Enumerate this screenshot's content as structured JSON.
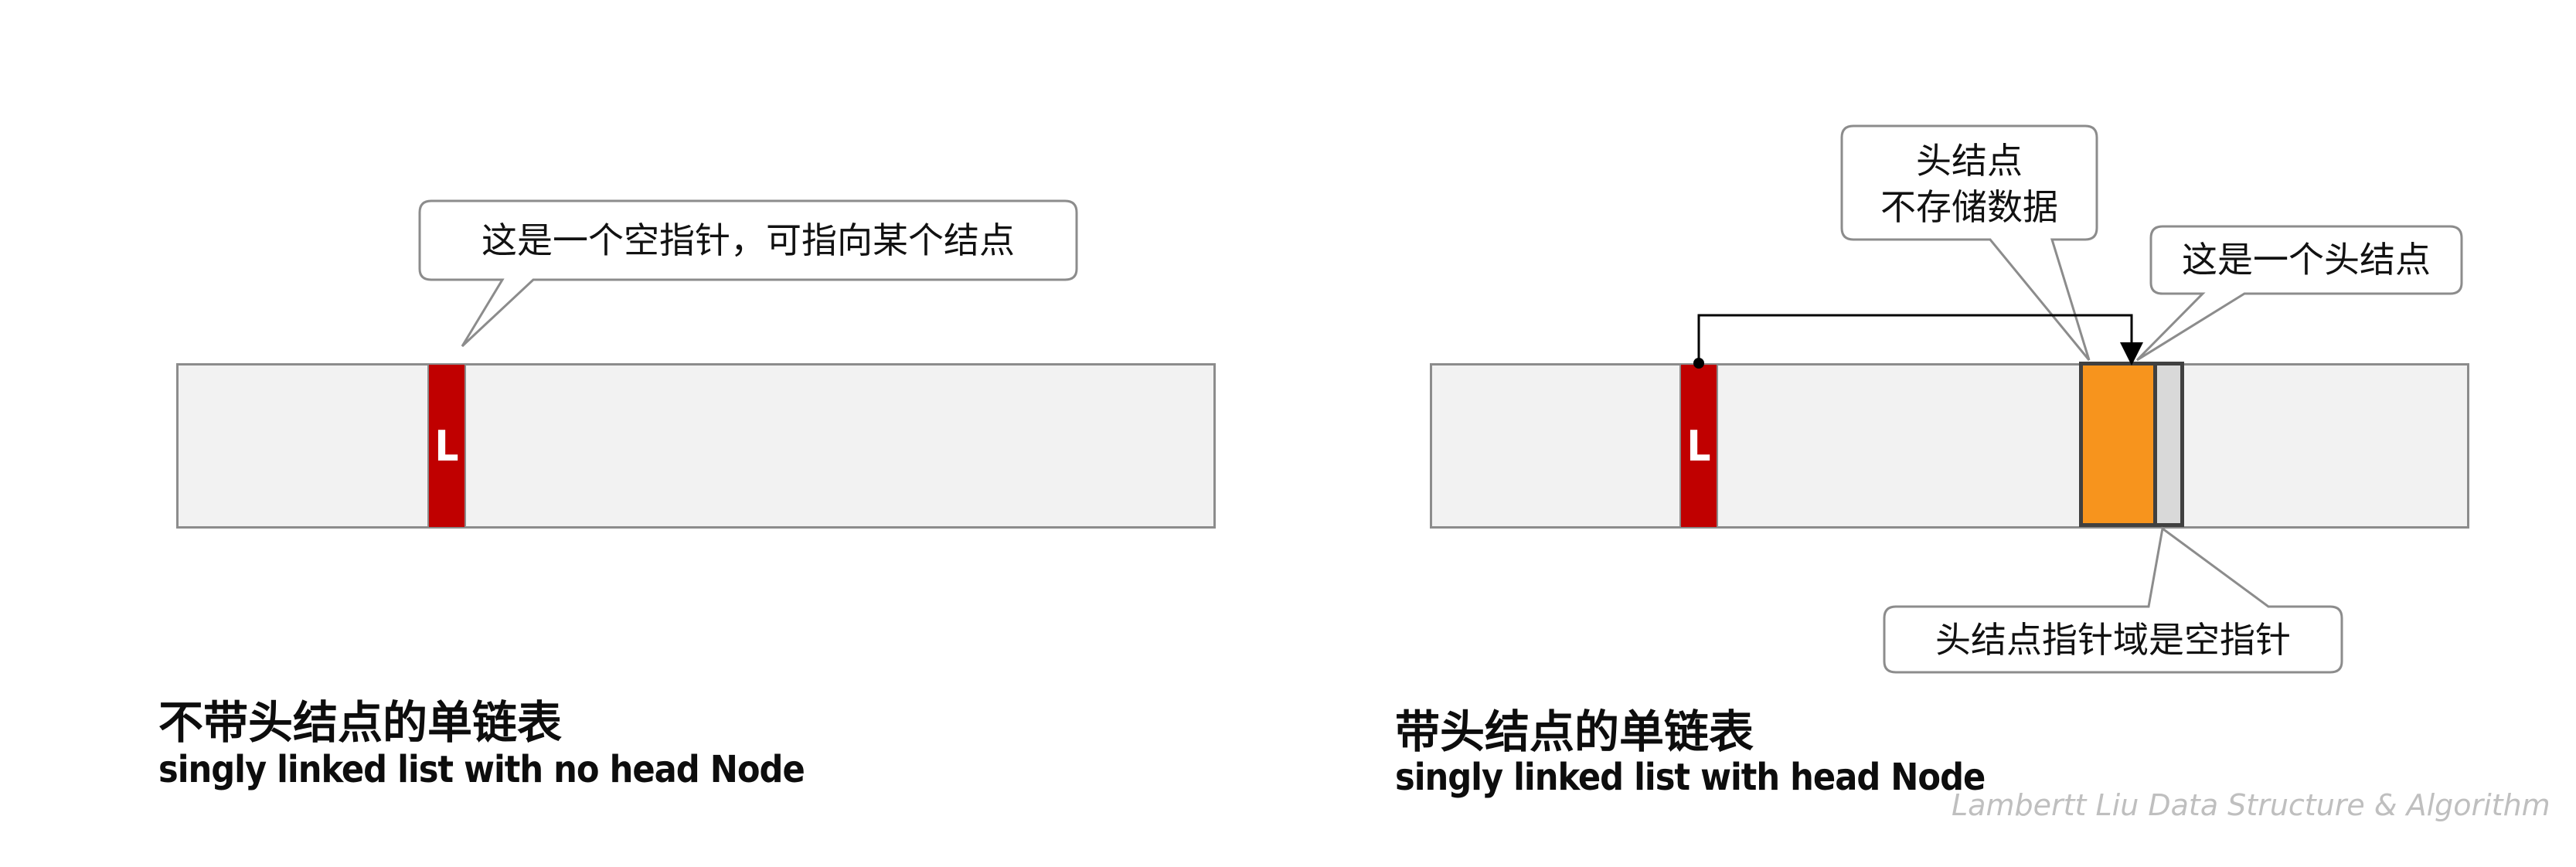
{
  "left_diagram": {
    "cell_label": "L",
    "callout": "这是一个空指针，可指向某个结点",
    "title_cn": "不带头结点的单链表",
    "title_en": "singly linked list with no head Node"
  },
  "right_diagram": {
    "cell_label": "L",
    "callout_head_node_line1": "头结点",
    "callout_head_node_line2": "不存储数据",
    "callout_is_head": "这是一个头结点",
    "callout_pointer_field": "头结点指针域是空指针",
    "title_cn": "带头结点的单链表",
    "title_en": "singly linked list with head Node"
  },
  "watermark": "Lambertt Liu    Data Structure & Algorithm",
  "colors": {
    "pointer_red": "#c00000",
    "head_node_orange": "#f7941d",
    "memory_gray": "#f2f2f2",
    "border_gray": "#8c8c8c"
  }
}
